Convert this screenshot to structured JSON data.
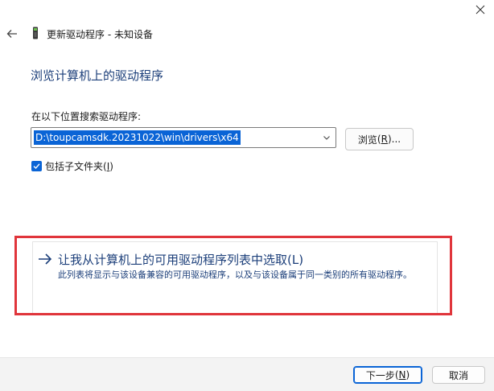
{
  "window": {
    "title": "更新驱动程序 - 未知设备",
    "icons": {
      "close": "close-icon",
      "back": "back-arrow-icon",
      "app": "device-icon"
    }
  },
  "main": {
    "heading": "浏览计算机上的驱动程序",
    "path_label": "在以下位置搜索驱动程序:",
    "path_value": "D:\\toupcamsdk.20231022\\win\\drivers\\x64",
    "browse_label": "浏览",
    "browse_accel": "R",
    "browse_suffix": "...",
    "include_subfolders_label": "包括子文件夹",
    "include_subfolders_accel": "I",
    "include_subfolders_checked": true
  },
  "option": {
    "title": "让我从计算机上的可用驱动程序列表中选取(L)",
    "description": "此列表将显示与该设备兼容的可用驱动程序，以及与该设备属于同一类别的所有驱动程序。",
    "highlight_color": "#e0353b"
  },
  "footer": {
    "next_label": "下一步",
    "next_accel": "N",
    "cancel_label": "取消"
  },
  "colors": {
    "accent": "#0a64d6",
    "link_text": "#1c3f7a"
  }
}
